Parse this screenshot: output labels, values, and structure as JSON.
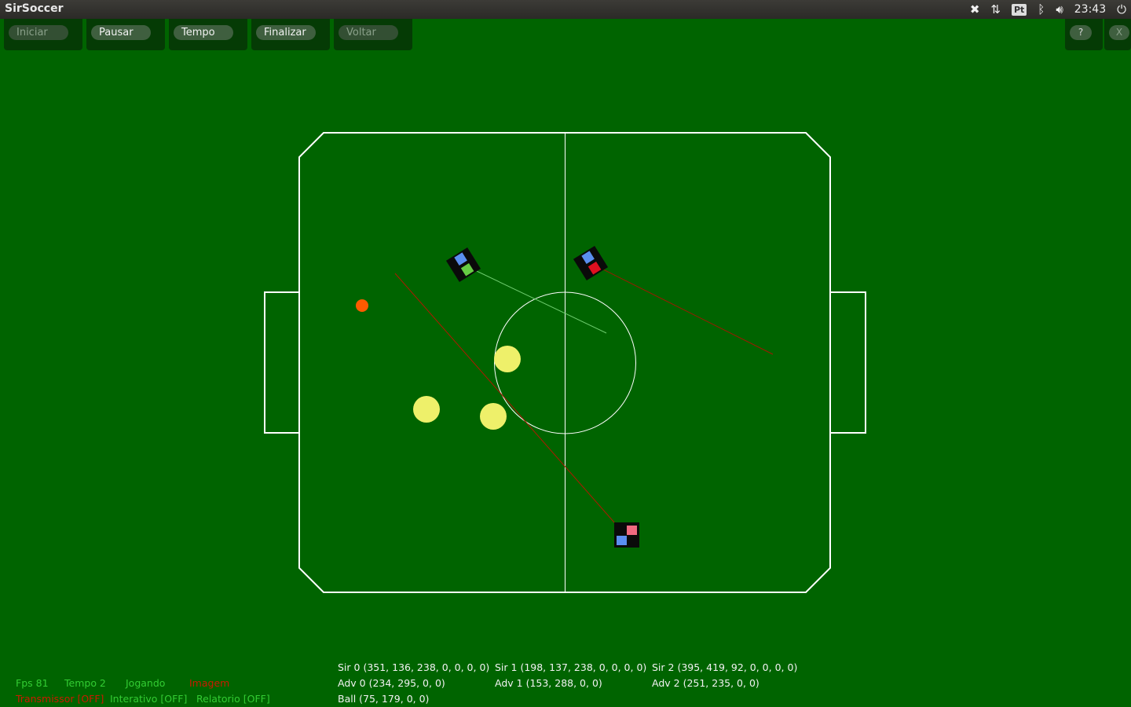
{
  "window": {
    "title": "SirSoccer"
  },
  "tray": {
    "keyboard_layout": "Pt",
    "clock": "23:43",
    "icons": [
      "dropbox-icon",
      "network-icon",
      "keyboard-layout-icon",
      "bluetooth-icon",
      "volume-icon",
      "power-icon"
    ]
  },
  "toolbar": {
    "start_label": "Iniciar",
    "pause_label": "Pausar",
    "time_label": "Tempo",
    "finish_label": "Finalizar",
    "back_label": "Voltar",
    "help_label": "?",
    "close_label": "X"
  },
  "status": {
    "fps": "Fps 81",
    "tempo": "Tempo 2",
    "state": "Jogando",
    "image": "Imagem",
    "transmitter": "Transmissor [OFF]",
    "interactive": "Interativo [OFF]",
    "report": "Relatorio [OFF]"
  },
  "telemetry": {
    "sir0": "Sir 0 (351, 136, 238, 0, 0, 0, 0)",
    "sir1": "Sir 1 (198, 137, 238, 0, 0, 0, 0)",
    "sir2": "Sir 2 (395, 419, 92, 0, 0, 0, 0)",
    "adv0": "Adv 0 (234, 295, 0, 0)",
    "adv1": "Adv 1 (153, 288, 0, 0)",
    "adv2": "Adv 2 (251, 235, 0, 0)",
    "ball": "Ball (75, 179, 0, 0)"
  },
  "colors": {
    "field": "#006400",
    "lines": "#ffffff",
    "ball": "#ff5a00",
    "opponent": "#eef06a",
    "robot_body": "#0a0a0a",
    "team_marker": "#5a8ff0",
    "status_green": "#33cc33",
    "status_red": "#cc1a00"
  }
}
